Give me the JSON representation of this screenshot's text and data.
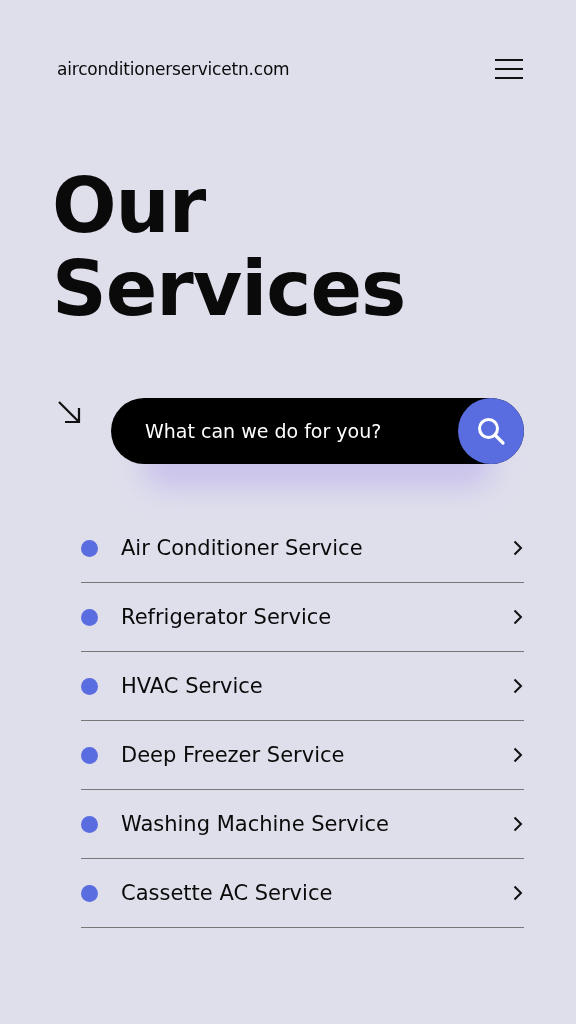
{
  "header": {
    "site": "airconditionerservicetn.com"
  },
  "title": [
    "Our",
    "Services"
  ],
  "search": {
    "placeholder": "What can we do for you?"
  },
  "services": [
    {
      "label": "Air Conditioner Service"
    },
    {
      "label": "Refrigerator Service"
    },
    {
      "label": "HVAC Service"
    },
    {
      "label": "Deep Freezer Service"
    },
    {
      "label": "Washing Machine Service"
    },
    {
      "label": "Cassette AC Service"
    }
  ]
}
